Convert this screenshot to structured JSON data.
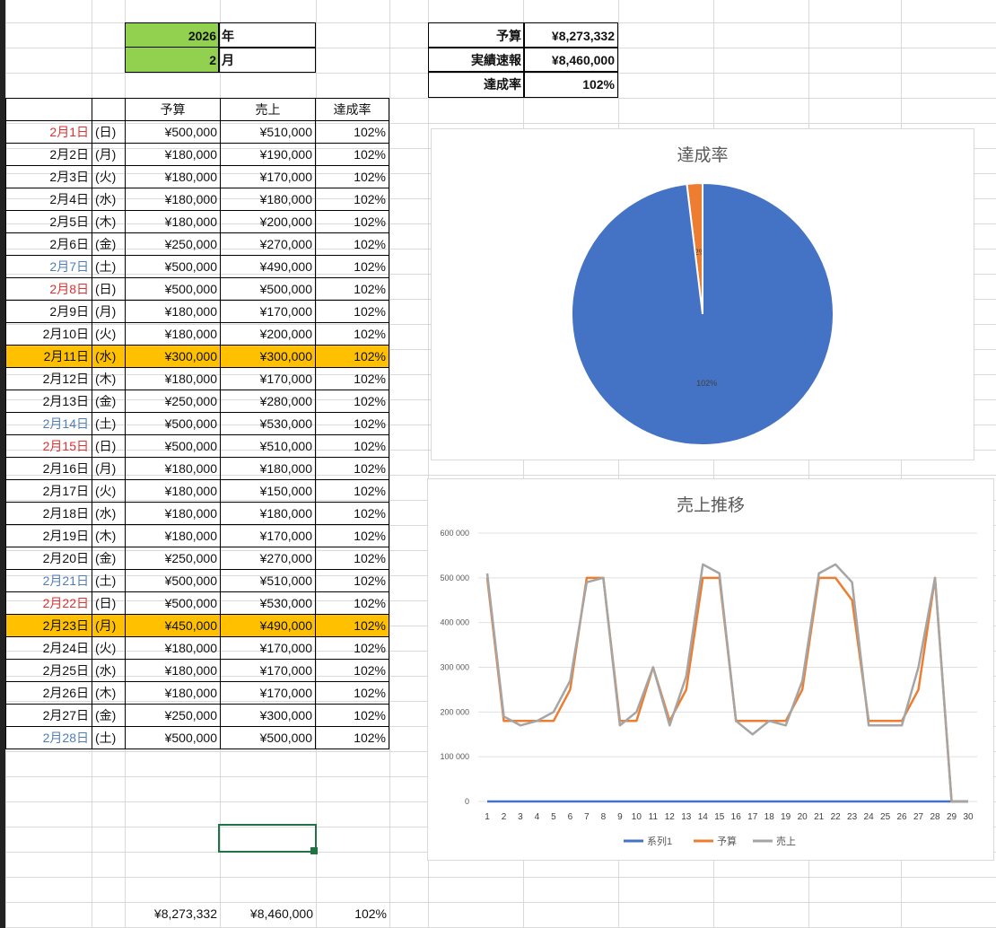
{
  "header": {
    "year": "2026",
    "year_unit": "年",
    "month": "2",
    "month_unit": "月"
  },
  "summary": {
    "budget_label": "予算",
    "budget_value": "¥8,273,332",
    "actual_label": "実績速報",
    "actual_value": "¥8,460,000",
    "rate_label": "達成率",
    "rate_value": "102%"
  },
  "table": {
    "headers": [
      "予算",
      "売上",
      "達成率"
    ],
    "rows": [
      {
        "date": "2月1日",
        "dow": "(日)",
        "budget": "¥500,000",
        "sales": "¥510,000",
        "rate": "102%",
        "color": "red",
        "hl": false
      },
      {
        "date": "2月2日",
        "dow": "(月)",
        "budget": "¥180,000",
        "sales": "¥190,000",
        "rate": "102%",
        "color": "",
        "hl": false
      },
      {
        "date": "2月3日",
        "dow": "(火)",
        "budget": "¥180,000",
        "sales": "¥170,000",
        "rate": "102%",
        "color": "",
        "hl": false
      },
      {
        "date": "2月4日",
        "dow": "(水)",
        "budget": "¥180,000",
        "sales": "¥180,000",
        "rate": "102%",
        "color": "",
        "hl": false
      },
      {
        "date": "2月5日",
        "dow": "(木)",
        "budget": "¥180,000",
        "sales": "¥200,000",
        "rate": "102%",
        "color": "",
        "hl": false
      },
      {
        "date": "2月6日",
        "dow": "(金)",
        "budget": "¥250,000",
        "sales": "¥270,000",
        "rate": "102%",
        "color": "",
        "hl": false
      },
      {
        "date": "2月7日",
        "dow": "(土)",
        "budget": "¥500,000",
        "sales": "¥490,000",
        "rate": "102%",
        "color": "blue",
        "hl": false
      },
      {
        "date": "2月8日",
        "dow": "(日)",
        "budget": "¥500,000",
        "sales": "¥500,000",
        "rate": "102%",
        "color": "red",
        "hl": false
      },
      {
        "date": "2月9日",
        "dow": "(月)",
        "budget": "¥180,000",
        "sales": "¥170,000",
        "rate": "102%",
        "color": "",
        "hl": false
      },
      {
        "date": "2月10日",
        "dow": "(火)",
        "budget": "¥180,000",
        "sales": "¥200,000",
        "rate": "102%",
        "color": "",
        "hl": false
      },
      {
        "date": "2月11日",
        "dow": "(水)",
        "budget": "¥300,000",
        "sales": "¥300,000",
        "rate": "102%",
        "color": "",
        "hl": true
      },
      {
        "date": "2月12日",
        "dow": "(木)",
        "budget": "¥180,000",
        "sales": "¥170,000",
        "rate": "102%",
        "color": "",
        "hl": false
      },
      {
        "date": "2月13日",
        "dow": "(金)",
        "budget": "¥250,000",
        "sales": "¥280,000",
        "rate": "102%",
        "color": "",
        "hl": false
      },
      {
        "date": "2月14日",
        "dow": "(土)",
        "budget": "¥500,000",
        "sales": "¥530,000",
        "rate": "102%",
        "color": "blue",
        "hl": false
      },
      {
        "date": "2月15日",
        "dow": "(日)",
        "budget": "¥500,000",
        "sales": "¥510,000",
        "rate": "102%",
        "color": "red",
        "hl": false
      },
      {
        "date": "2月16日",
        "dow": "(月)",
        "budget": "¥180,000",
        "sales": "¥180,000",
        "rate": "102%",
        "color": "",
        "hl": false
      },
      {
        "date": "2月17日",
        "dow": "(火)",
        "budget": "¥180,000",
        "sales": "¥150,000",
        "rate": "102%",
        "color": "",
        "hl": false
      },
      {
        "date": "2月18日",
        "dow": "(水)",
        "budget": "¥180,000",
        "sales": "¥180,000",
        "rate": "102%",
        "color": "",
        "hl": false
      },
      {
        "date": "2月19日",
        "dow": "(木)",
        "budget": "¥180,000",
        "sales": "¥170,000",
        "rate": "102%",
        "color": "",
        "hl": false
      },
      {
        "date": "2月20日",
        "dow": "(金)",
        "budget": "¥250,000",
        "sales": "¥270,000",
        "rate": "102%",
        "color": "",
        "hl": false
      },
      {
        "date": "2月21日",
        "dow": "(土)",
        "budget": "¥500,000",
        "sales": "¥510,000",
        "rate": "102%",
        "color": "blue",
        "hl": false
      },
      {
        "date": "2月22日",
        "dow": "(日)",
        "budget": "¥500,000",
        "sales": "¥530,000",
        "rate": "102%",
        "color": "red",
        "hl": false
      },
      {
        "date": "2月23日",
        "dow": "(月)",
        "budget": "¥450,000",
        "sales": "¥490,000",
        "rate": "102%",
        "color": "",
        "hl": true
      },
      {
        "date": "2月24日",
        "dow": "(火)",
        "budget": "¥180,000",
        "sales": "¥170,000",
        "rate": "102%",
        "color": "",
        "hl": false
      },
      {
        "date": "2月25日",
        "dow": "(水)",
        "budget": "¥180,000",
        "sales": "¥170,000",
        "rate": "102%",
        "color": "",
        "hl": false
      },
      {
        "date": "2月26日",
        "dow": "(木)",
        "budget": "¥180,000",
        "sales": "¥170,000",
        "rate": "102%",
        "color": "",
        "hl": false
      },
      {
        "date": "2月27日",
        "dow": "(金)",
        "budget": "¥250,000",
        "sales": "¥300,000",
        "rate": "102%",
        "color": "",
        "hl": false
      },
      {
        "date": "2月28日",
        "dow": "(土)",
        "budget": "¥500,000",
        "sales": "¥500,000",
        "rate": "102%",
        "color": "blue",
        "hl": false
      }
    ],
    "totals": {
      "budget": "¥8,273,332",
      "sales": "¥8,460,000",
      "rate": "102%"
    }
  },
  "colors": {
    "highlight": "#ffc000",
    "green": "#92d050",
    "sunday": "#e03030",
    "saturday": "#4f7fb8",
    "selection": "#217346"
  },
  "chart_data": [
    {
      "type": "pie",
      "title": "達成率",
      "slices": [
        {
          "label": "102%",
          "value": 102,
          "color": "#4472c4"
        },
        {
          "label": "-2%",
          "value": 2,
          "color": "#ed7d31"
        }
      ]
    },
    {
      "type": "line",
      "title": "売上推移",
      "x": [
        1,
        2,
        3,
        4,
        5,
        6,
        7,
        8,
        9,
        10,
        11,
        12,
        13,
        14,
        15,
        16,
        17,
        18,
        19,
        20,
        21,
        22,
        23,
        24,
        25,
        26,
        27,
        28,
        29,
        30
      ],
      "ylim": [
        0,
        600000
      ],
      "yticks": [
        "0",
        "100 000",
        "200 000",
        "300 000",
        "400 000",
        "500 000",
        "600 000"
      ],
      "series": [
        {
          "name": "系列1",
          "color": "#4472c4",
          "values": [
            0,
            0,
            1,
            1,
            1,
            1,
            1,
            0,
            0,
            0,
            0,
            0,
            0,
            0,
            0,
            0,
            0,
            0,
            0,
            0,
            0,
            0,
            0,
            0,
            0,
            0,
            0,
            0,
            0,
            0
          ]
        },
        {
          "name": "予算",
          "color": "#ed7d31",
          "values": [
            500000,
            180000,
            180000,
            180000,
            180000,
            250000,
            500000,
            500000,
            180000,
            180000,
            300000,
            180000,
            250000,
            500000,
            500000,
            180000,
            180000,
            180000,
            180000,
            250000,
            500000,
            500000,
            450000,
            180000,
            180000,
            180000,
            250000,
            500000,
            0,
            0
          ]
        },
        {
          "name": "売上",
          "color": "#a5a5a5",
          "values": [
            510000,
            190000,
            170000,
            180000,
            200000,
            270000,
            490000,
            500000,
            170000,
            200000,
            300000,
            170000,
            280000,
            530000,
            510000,
            180000,
            150000,
            180000,
            170000,
            270000,
            510000,
            530000,
            490000,
            170000,
            170000,
            170000,
            300000,
            500000,
            0,
            0
          ]
        }
      ],
      "legend": "bottom"
    }
  ]
}
